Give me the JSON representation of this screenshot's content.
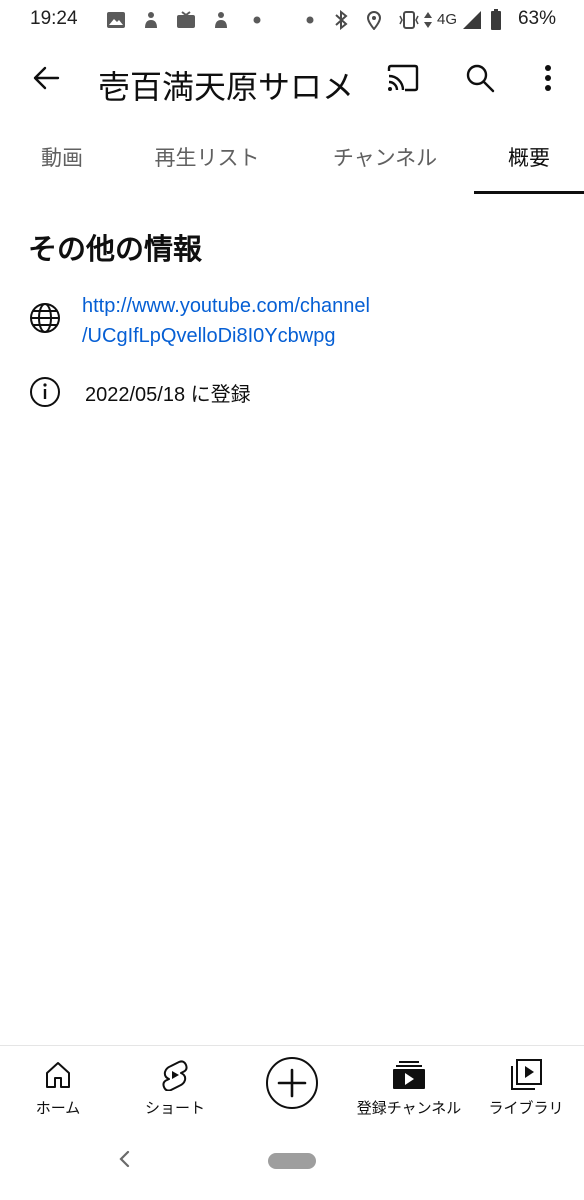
{
  "status_bar": {
    "time": "19:24",
    "network": "4G",
    "battery": "63%",
    "icons": [
      "gallery-icon",
      "app-notification-icon",
      "tv-icon",
      "app-notification-icon",
      "dot-icon",
      "dot-icon",
      "bluetooth-icon",
      "location-icon",
      "vibrate-icon",
      "signal-icon",
      "battery-icon"
    ]
  },
  "header": {
    "title": "壱百満天原サロメ",
    "icons": [
      "back-arrow-icon",
      "cast-icon",
      "search-icon",
      "more-vert-icon"
    ]
  },
  "tabs": [
    {
      "label": "動画",
      "active": false
    },
    {
      "label": "再生リスト",
      "active": false
    },
    {
      "label": "チャンネル",
      "active": false
    },
    {
      "label": "概要",
      "active": true
    }
  ],
  "about": {
    "section_title": "その他の情報",
    "link_line1": "http://www.youtube.com/channel",
    "link_line2": "/UCgIfLpQvelloDi8I0Ycbwpg",
    "joined_text": "2022/05/18 に登録"
  },
  "bottom_nav": {
    "items": [
      {
        "label": "ホーム",
        "icon": "home-icon"
      },
      {
        "label": "ショート",
        "icon": "shorts-icon"
      },
      {
        "label": "",
        "icon": "create-plus-icon"
      },
      {
        "label": "登録チャンネル",
        "icon": "subscriptions-icon"
      },
      {
        "label": "ライブラリ",
        "icon": "library-icon"
      }
    ]
  },
  "colors": {
    "link": "#065fd4",
    "text_primary": "#0f0f0f",
    "text_secondary": "#606060",
    "background": "#ffffff"
  }
}
